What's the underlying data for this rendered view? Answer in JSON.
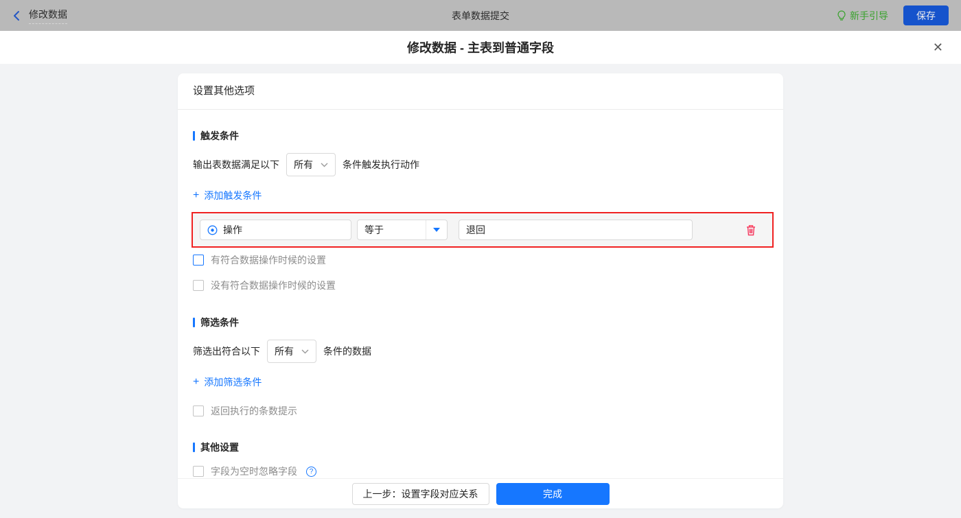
{
  "topbar": {
    "back_label": "修改数据",
    "title": "表单数据提交",
    "guide_label": "新手引导",
    "save_label": "保存"
  },
  "dialog": {
    "title": "修改数据 - 主表到普通字段"
  },
  "icons": {
    "close": "✕",
    "plus": "+",
    "help": "?"
  },
  "panel": {
    "header": "设置其他选项",
    "trigger": {
      "title": "触发条件",
      "prefix": "输出表数据满足以下",
      "match_select": "所有",
      "suffix": "条件触发执行动作",
      "add_label": "添加触发条件",
      "row": {
        "field": "操作",
        "operator": "等于",
        "value": "退回"
      },
      "checkbox_has": "有符合数据操作时候的设置",
      "checkbox_none": "没有符合数据操作时候的设置"
    },
    "filter": {
      "title": "筛选条件",
      "prefix": "筛选出符合以下",
      "match_select": "所有",
      "suffix": "条件的数据",
      "add_label": "添加筛选条件",
      "checkbox_count": "返回执行的条数提示"
    },
    "other": {
      "title": "其他设置",
      "checkbox_ignore": "字段为空时忽略字段"
    },
    "footer": {
      "prev": "上一步：设置字段对应关系",
      "done": "完成"
    }
  },
  "colors": {
    "accent": "#1677ff",
    "annotation_red": "#f02121",
    "guide_green": "#3aa22e",
    "topbar_bg": "#b9b9b9"
  }
}
